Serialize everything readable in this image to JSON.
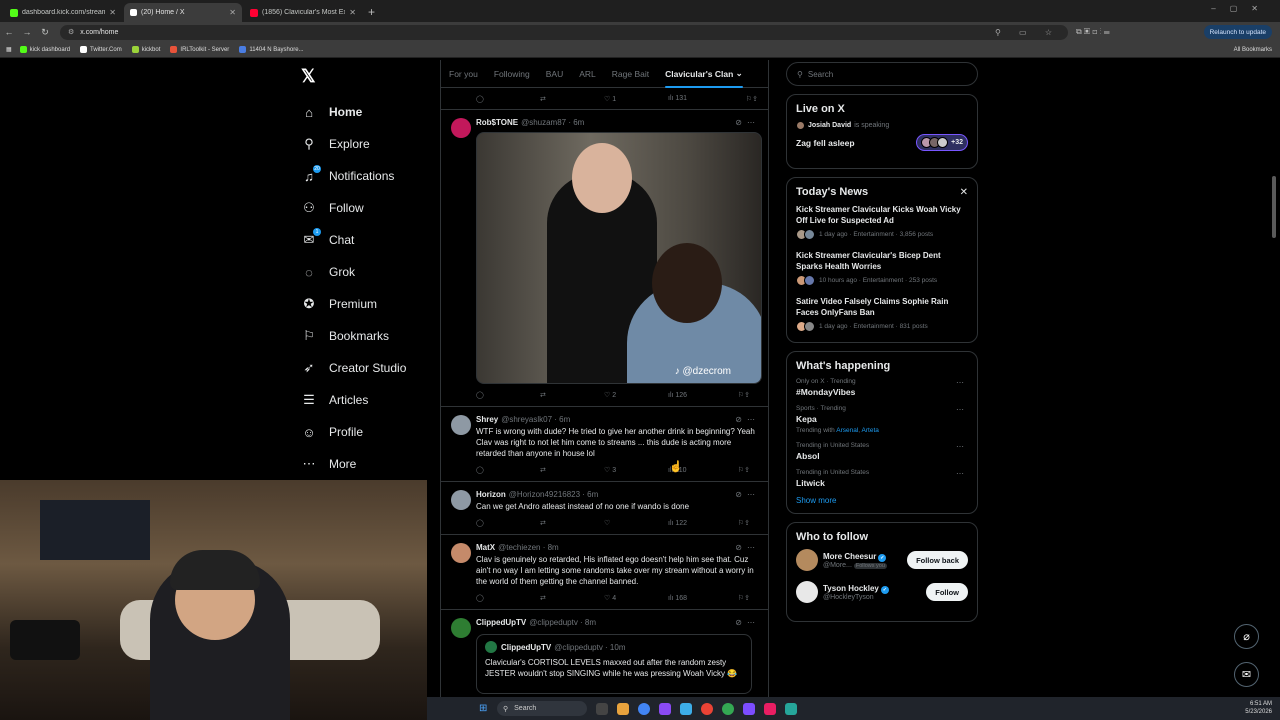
{
  "browser": {
    "tabs": [
      {
        "title": "dashboard.kick.com/stream",
        "color": "#53fc18"
      },
      {
        "title": "(20) Home / X",
        "color": "#ffffff"
      },
      {
        "title": "(1856) Clavicular's Most Extrem",
        "color": "#ff0033"
      }
    ],
    "url": "x.com/home",
    "relaunch_label": "Relaunch to update",
    "bookmarks": [
      {
        "label": "kick dashboard",
        "color": "#53fc18"
      },
      {
        "label": "Twitter.Com",
        "color": "#ffffff"
      },
      {
        "label": "kickbot",
        "color": "#9bd33a"
      },
      {
        "label": "IRLToolkit - Server",
        "color": "#e8533a"
      },
      {
        "label": "11404 N Bayshore...",
        "color": "#4a7de2"
      }
    ],
    "all_bookmarks": "All Bookmarks"
  },
  "nav": {
    "logo": "𝕏",
    "notifications_badge": "20",
    "chat_badge": "1",
    "items": [
      {
        "label": "Home",
        "icon": "home-icon",
        "glyph": "⌂"
      },
      {
        "label": "Explore",
        "icon": "search-icon",
        "glyph": "⚲"
      },
      {
        "label": "Notifications",
        "icon": "bell-icon",
        "glyph": "♫"
      },
      {
        "label": "Follow",
        "icon": "follow-icon",
        "glyph": "⚇"
      },
      {
        "label": "Chat",
        "icon": "chat-icon",
        "glyph": "✉"
      },
      {
        "label": "Grok",
        "icon": "grok-icon",
        "glyph": "◌"
      },
      {
        "label": "Premium",
        "icon": "premium-icon",
        "glyph": "✪"
      },
      {
        "label": "Bookmarks",
        "icon": "bookmark-icon",
        "glyph": "⚐"
      },
      {
        "label": "Creator Studio",
        "icon": "rocket-icon",
        "glyph": "➶"
      },
      {
        "label": "Articles",
        "icon": "articles-icon",
        "glyph": "☰"
      },
      {
        "label": "Profile",
        "icon": "profile-icon",
        "glyph": "☺"
      },
      {
        "label": "More",
        "icon": "more-icon",
        "glyph": "⋯"
      }
    ]
  },
  "feed": {
    "tabs": [
      "For you",
      "Following",
      "BAU",
      "ARL",
      "Rage Bait",
      "Clavicular's Clan"
    ],
    "top_actions": {
      "likes": "1",
      "views": "131"
    },
    "tweets": [
      {
        "name": "Rob$TONE",
        "handle": "@shuzam87 · 6m",
        "text": "",
        "replies": "",
        "reposts": "",
        "likes": "2",
        "views": "126",
        "media_tag": "♪ @dzecrom",
        "avatar_color": "#c2185b"
      },
      {
        "name": "Shrey",
        "handle": "@shreyaslk07 · 6m",
        "text": "WTF is wrong with dude? He tried to give her another drink in beginning? Yeah Clav was right to not let him come to streams ... this dude is acting more retarded than anyone in house lol",
        "replies": "",
        "reposts": "",
        "likes": "3",
        "views": "110",
        "avatar_color": "#8e99a4"
      },
      {
        "name": "Horizon",
        "handle": "@Horizon49216823 · 6m",
        "text": "Can we get Andro atleast instead of no one if wando is done",
        "replies": "",
        "reposts": "",
        "likes": "",
        "views": "122",
        "avatar_color": "#8e99a4"
      },
      {
        "name": "MatX",
        "handle": "@techiezen · 8m",
        "text": "Clav is genuinely so retarded, His inflated ego doesn't help him see that. Cuz ain't no way I am letting some randoms take over my stream without a worry in the world of them getting the channel banned.",
        "replies": "",
        "reposts": "",
        "likes": "4",
        "views": "168",
        "avatar_color": "#c58a6a"
      },
      {
        "name": "ClippedUpTV",
        "handle": "@clippeduptv · 8m",
        "text": "",
        "avatar_color": "#2e7d32"
      }
    ],
    "quote": {
      "name": "ClippedUpTV",
      "handle": "@clippeduptv · 10m",
      "text": "Clavicular's CORTISOL LEVELS maxxed out after the random zesty JESTER wouldn't stop SINGING while he was pressing Woah Vicky 😂"
    }
  },
  "right": {
    "search_placeholder": "Search",
    "live": {
      "heading": "Live on X",
      "speaker": "Josiah David",
      "speaking": "is speaking",
      "topic": "Zag fell asleep",
      "count": "+32"
    },
    "news": {
      "heading": "Today's News",
      "items": [
        {
          "title": "Kick Streamer Clavicular Kicks Woah Vicky Off Live for Suspected Ad",
          "meta": "1 day ago · Entertainment · 3,856 posts"
        },
        {
          "title": "Kick Streamer Clavicular's Bicep Dent Sparks Health Worries",
          "meta": "10 hours ago · Entertainment · 253 posts"
        },
        {
          "title": "Satire Video Falsely Claims Sophie Rain Faces OnlyFans Ban",
          "meta": "1 day ago · Entertainment · 831 posts"
        }
      ]
    },
    "happening": {
      "heading": "What's happening",
      "trends": [
        {
          "context": "Only on X · Trending",
          "title": "#MondayVibes",
          "with": ""
        },
        {
          "context": "Sports · Trending",
          "title": "Kepa",
          "with_label": "Trending with",
          "with_a": "Arsenal",
          "with_b": "Arteta"
        },
        {
          "context": "Trending in United States",
          "title": "Absol"
        },
        {
          "context": "Trending in United States",
          "title": "Litwick"
        }
      ],
      "show_more": "Show more"
    },
    "who_to_follow": {
      "heading": "Who to follow",
      "users": [
        {
          "name": "More Cheesur",
          "handle": "@More...",
          "follows_you": "Follows you",
          "button": "Follow back"
        },
        {
          "name": "Tyson Hockley",
          "handle": "@HockleyTyson",
          "button": "Follow"
        }
      ]
    }
  },
  "taskbar": {
    "search": "Search",
    "time": "6:51 AM",
    "date": "5/23/2026"
  }
}
